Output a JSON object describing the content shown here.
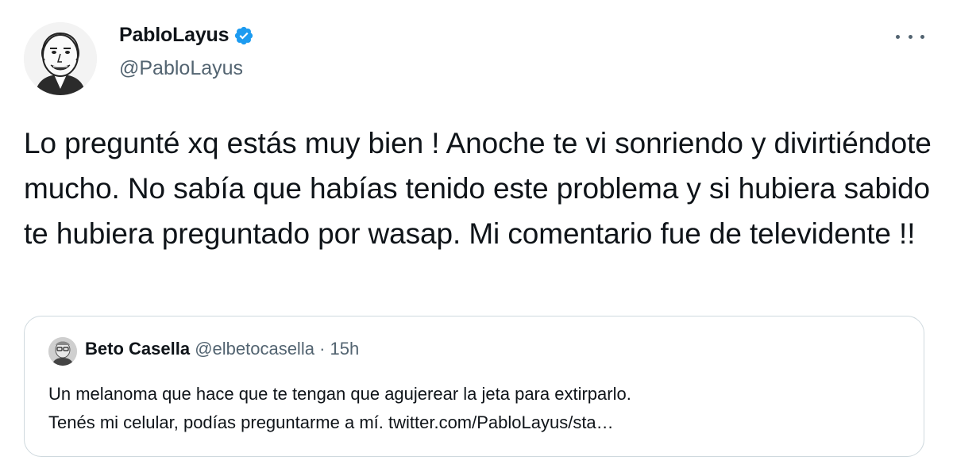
{
  "tweet": {
    "author": {
      "name": "PabloLayus",
      "handle": "@PabloLayus",
      "verified": true
    },
    "text": "Lo pregunté xq estás muy bien ! Anoche te vi sonriendo y divirtiéndote mucho. No sabía que habías tenido este problema y si hubiera sabido te hubiera preguntado por wasap. Mi comentario fue de televidente !!",
    "more_icon": "more-horizontal-icon"
  },
  "quote": {
    "name": "Beto Casella",
    "handle": "@elbetocasella",
    "dot": "·",
    "time": "15h",
    "text_line1": "Un melanoma que hace que te tengan que agujerear la jeta para extirparlo.",
    "text_line2": "Tenés mi celular, podías preguntarme a mí. twitter.com/PabloLayus/sta…"
  },
  "colors": {
    "text": "#0f1419",
    "secondary": "#536471",
    "verified": "#1d9bf0",
    "border": "#cfd9de"
  }
}
